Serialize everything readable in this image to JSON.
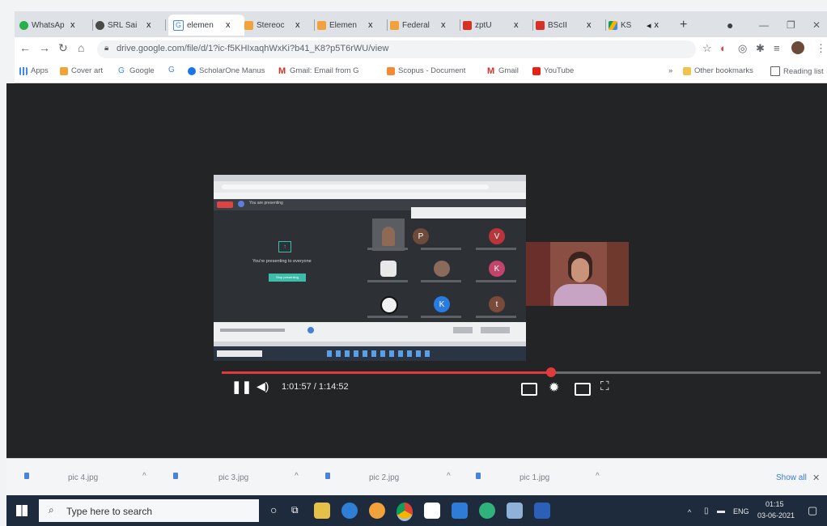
{
  "tabs": [
    {
      "label": "WhatsAp",
      "icon": "whatsapp-icon",
      "color": "#25b04a"
    },
    {
      "label": "SRL Sai",
      "icon": "globe-icon",
      "color": "#4a4a4a"
    },
    {
      "label": "elemen",
      "icon": "google-icon",
      "color": "#4285f4"
    },
    {
      "label": "Stereoc",
      "icon": "scholar-icon",
      "color": "#f2a23b"
    },
    {
      "label": "Elemen",
      "icon": "scholar-icon",
      "color": "#f2a23b"
    },
    {
      "label": "Federal",
      "icon": "scholar-icon",
      "color": "#f2a23b"
    },
    {
      "label": "zptU",
      "icon": "gmail-icon",
      "color": "#d93025"
    },
    {
      "label": "BScII",
      "icon": "gmail-icon",
      "color": "#d93025"
    },
    {
      "label": "KS",
      "icon": "drive-icon",
      "color": "#1a73e8"
    }
  ],
  "tab_close": "x",
  "new_tab": "+",
  "url": "drive.google.com/file/d/1?ic-f5KHIxaqhWxKi?b41_K8?p5T6rWU/view",
  "bookmarks": [
    {
      "label": "Apps",
      "color": "#4285f4"
    },
    {
      "label": "Cover art",
      "color": "#f2a23b"
    },
    {
      "label": "Google",
      "color": "#4285f4"
    },
    {
      "label": "",
      "color": "#4285f4"
    },
    {
      "label": "ScholarOne Manus",
      "color": "#1a73e8"
    },
    {
      "label": "Gmail: Email from G",
      "color": "#d93025"
    },
    {
      "label": "Scopus - Document",
      "color": "#f28b31"
    },
    {
      "label": "Gmail",
      "color": "#d93025"
    },
    {
      "label": "YouTube",
      "color": "#e62117"
    }
  ],
  "other_bookmarks": "Other bookmarks",
  "reading_list": "Reading list",
  "presentation": {
    "presenting_label": "You're presenting to everyone",
    "stop_button": "Stop presenting",
    "present_bar": "You are presenting",
    "participants": [
      {
        "initial": "P",
        "color": "#6d4a3a"
      },
      {
        "initial": "V",
        "color": "#b8353b"
      },
      {
        "initial": "K",
        "color": "#c2446a"
      },
      {
        "initial": "K",
        "color": "#2a7be0"
      },
      {
        "initial": "t",
        "color": "#7a4a3a"
      }
    ]
  },
  "player": {
    "time": "1:01:57 / 1:14:52",
    "progress_fraction": 0.55
  },
  "downloads": [
    {
      "name": "pic 4.jpg"
    },
    {
      "name": "pic 3.jpg"
    },
    {
      "name": "pic 2.jpg"
    },
    {
      "name": "pic 1.jpg"
    }
  ],
  "show_all": "Show all",
  "taskbar": {
    "search_placeholder": "Type here to search",
    "lang": "ENG",
    "clock_time": "01:15",
    "clock_date": "03-06-2021"
  },
  "colors": {
    "progress": "#e23a3a",
    "taskbar": "#1e2b3c"
  }
}
